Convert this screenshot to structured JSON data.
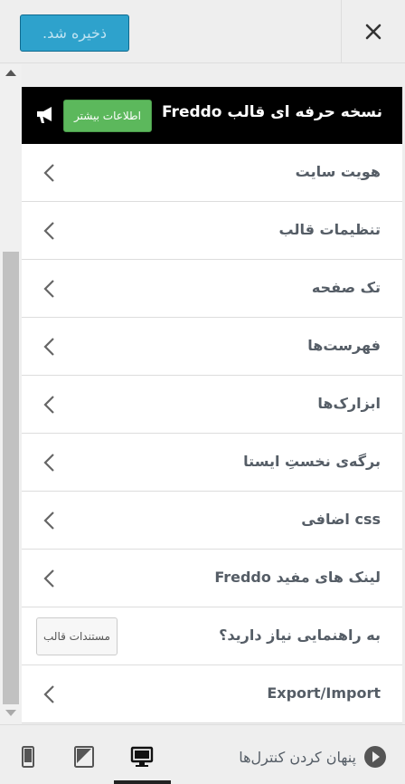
{
  "header": {
    "save_label": "ذخیره شد."
  },
  "promo": {
    "title": "نسخه حرفه ای قالب Freddo",
    "button_label": "اطلاعات بیشتر"
  },
  "menu": [
    {
      "label": "هویت سایت"
    },
    {
      "label": "تنظیمات قالب"
    },
    {
      "label": "تک صفحه"
    },
    {
      "label": "فهرست‌ها"
    },
    {
      "label": "ابزارک‌ها"
    },
    {
      "label": "برگه‌ی نخستِ ایستا"
    },
    {
      "label": "css اضافی"
    },
    {
      "label": "لینک های مفید Freddo"
    }
  ],
  "help": {
    "label": "به راهنمایی نیاز دارید؟",
    "button_label": "مستندات قالب"
  },
  "import_export": {
    "label": "Export/Import"
  },
  "footer": {
    "hide_controls_label": "پنهان کردن کنترل‌ها"
  },
  "colors": {
    "save_button": "#2ea2cc",
    "promo_bg": "#000000",
    "promo_button": "#5cb85c"
  }
}
